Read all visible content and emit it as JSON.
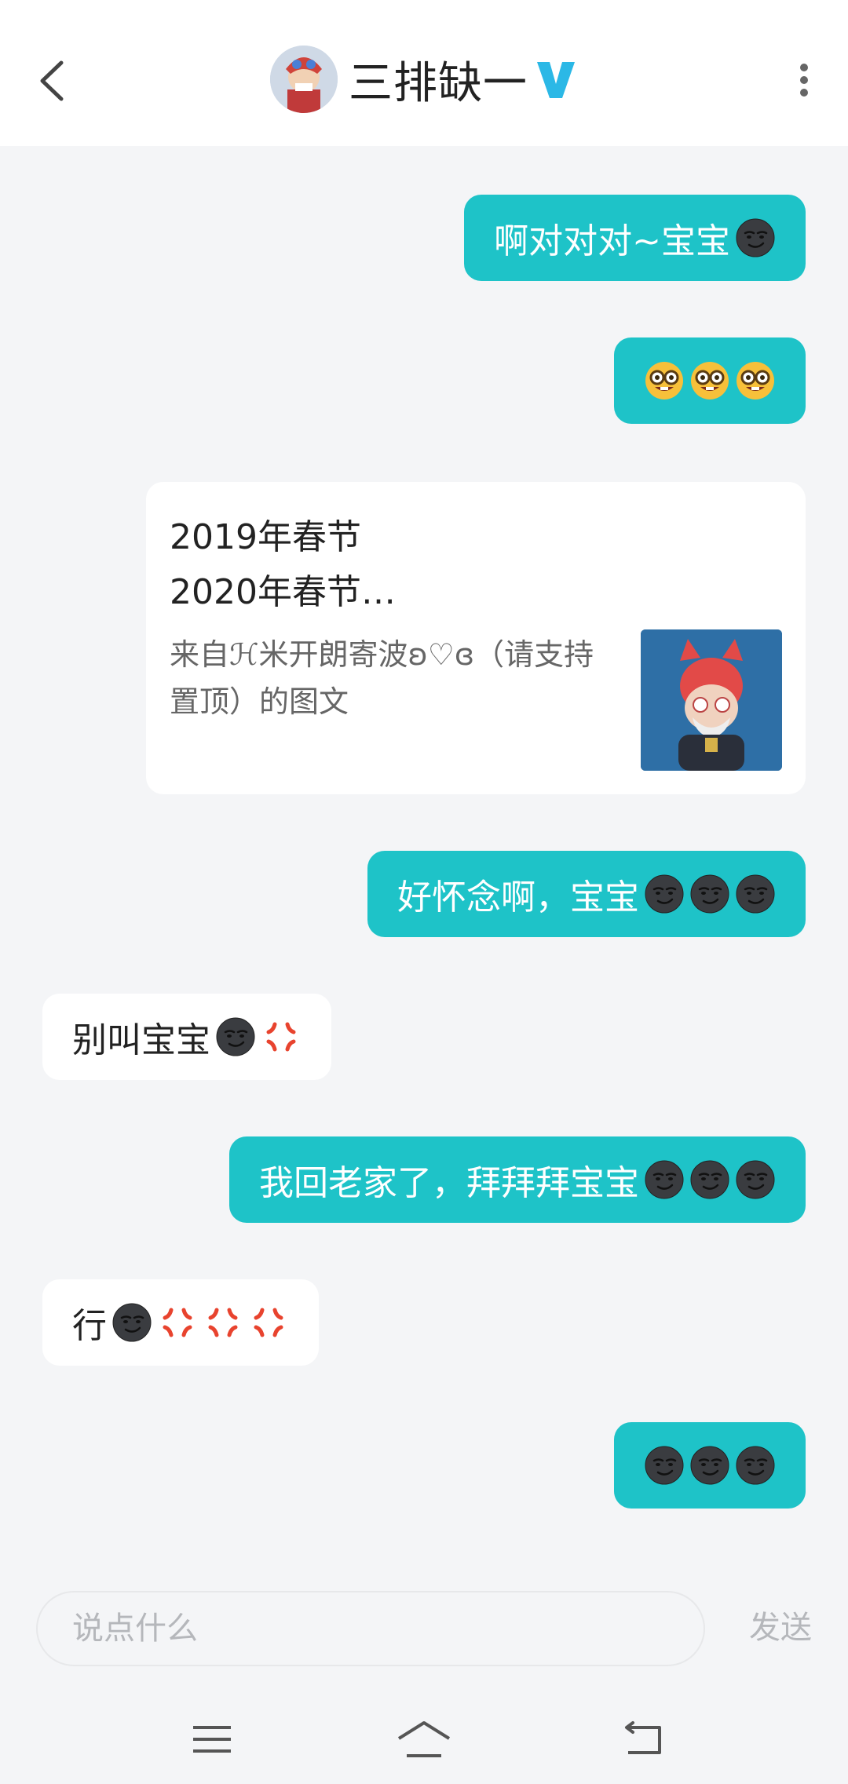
{
  "header": {
    "title": "三排缺一",
    "avatar_icon": "avatar-character",
    "verified_icon": "verified-v-icon",
    "more_icon": "more-vertical-icon",
    "back_icon": "back-arrow-icon"
  },
  "messages": [
    {
      "side": "me",
      "text": "啊对对对~宝宝",
      "emojis": [
        "smirk-dark"
      ]
    },
    {
      "side": "me",
      "text": "",
      "emojis": [
        "nerd",
        "nerd",
        "nerd"
      ]
    },
    {
      "side": "other",
      "type": "card"
    },
    {
      "side": "me",
      "text": "好怀念啊，宝宝",
      "emojis": [
        "smirk-dark",
        "smirk-dark",
        "smirk-dark"
      ]
    },
    {
      "side": "other",
      "text": "别叫宝宝",
      "emojis": [
        "smirk-dark",
        "anger"
      ]
    },
    {
      "side": "me",
      "text": "我回老家了，拜拜拜宝宝",
      "emojis": [
        "smirk-dark",
        "smirk-dark",
        "smirk-dark"
      ]
    },
    {
      "side": "other",
      "text": "行",
      "emojis": [
        "smirk-dark",
        "anger",
        "anger",
        "anger"
      ]
    },
    {
      "side": "me",
      "text": "",
      "emojis": [
        "smirk-dark",
        "smirk-dark",
        "smirk-dark"
      ]
    }
  ],
  "card": {
    "title_line1": "2019年春节",
    "title_line2": "2020年春节…",
    "desc_line1": "来自ℋ米开朗寄波ʚ♡ɞ（请支持",
    "desc_line2": "置顶）的图文",
    "thumb_icon": "bunny-hat-character"
  },
  "composer": {
    "placeholder": "说点什么",
    "send_label": "发送"
  },
  "navbar": {
    "icons": [
      "menu-icon",
      "home-icon",
      "back-icon"
    ]
  },
  "colors": {
    "accent": "#1ec3c8",
    "background": "#f4f5f7",
    "verified": "#2bb8e6"
  }
}
